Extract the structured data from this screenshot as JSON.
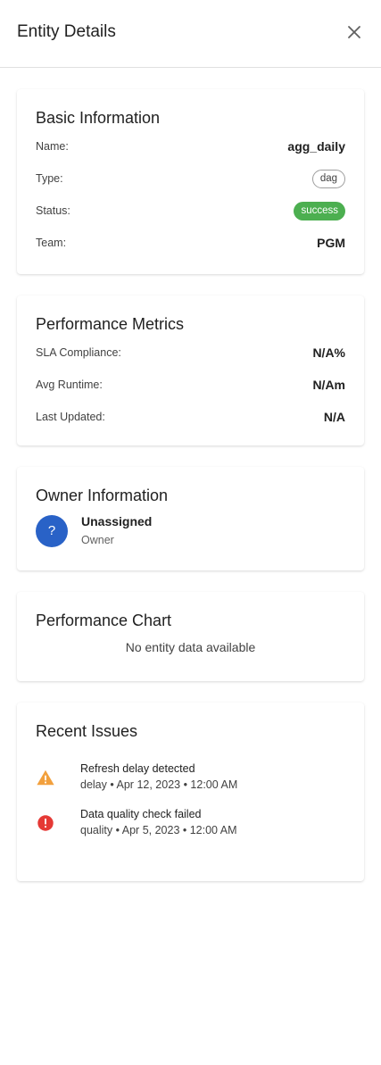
{
  "header": {
    "title": "Entity Details",
    "close_icon": "close-icon"
  },
  "basic_info": {
    "title": "Basic Information",
    "name_label": "Name:",
    "name_value": "agg_daily",
    "type_label": "Type:",
    "type_value": "dag",
    "status_label": "Status:",
    "status_value": "success",
    "status_color": "#4caf50",
    "team_label": "Team:",
    "team_value": "PGM"
  },
  "performance_metrics": {
    "title": "Performance Metrics",
    "sla_label": "SLA Compliance:",
    "sla_value": "N/A%",
    "runtime_label": "Avg Runtime:",
    "runtime_value": "N/Am",
    "updated_label": "Last Updated:",
    "updated_value": "N/A"
  },
  "owner": {
    "title": "Owner Information",
    "avatar_symbol": "?",
    "avatar_color": "#2962c7",
    "name": "Unassigned",
    "role": "Owner"
  },
  "performance_chart": {
    "title": "Performance Chart",
    "empty_message": "No entity data available"
  },
  "recent_issues": {
    "title": "Recent Issues",
    "items": [
      {
        "icon": "warning-icon",
        "color": "#f2a03d",
        "title": "Refresh delay detected",
        "meta": "delay • Apr 12, 2023 • 12:00 AM"
      },
      {
        "icon": "error-icon",
        "color": "#e53935",
        "title": "Data quality check failed",
        "meta": "quality • Apr 5, 2023 • 12:00 AM"
      }
    ]
  }
}
